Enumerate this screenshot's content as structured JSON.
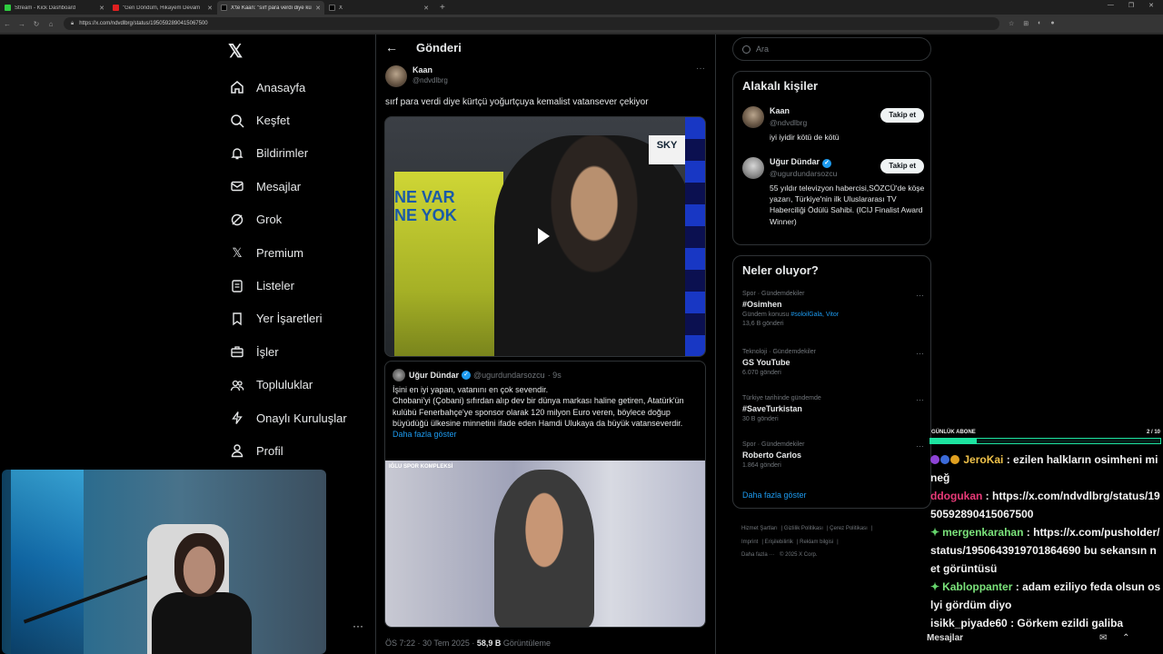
{
  "browser": {
    "tabs": [
      {
        "title": "Stream - Kick Dashboard",
        "color": "#2ecc40",
        "active": false
      },
      {
        "title": "\"Geri Döndüm, Hikayem Devam",
        "color": "#e02020",
        "active": false
      },
      {
        "title": "X'te Kaan: \"sırf para verdi diye kü",
        "color": "#000000",
        "active": true
      },
      {
        "title": "X",
        "color": "#000000",
        "active": false
      }
    ],
    "url": "https://x.com/ndvdlbrg/status/1950592890415067500"
  },
  "nav": {
    "items": [
      {
        "label": "Anasayfa",
        "icon": "home-icon"
      },
      {
        "label": "Keşfet",
        "icon": "search-icon"
      },
      {
        "label": "Bildirimler",
        "icon": "bell-icon"
      },
      {
        "label": "Mesajlar",
        "icon": "mail-icon"
      },
      {
        "label": "Grok",
        "icon": "grok-icon"
      },
      {
        "label": "Premium",
        "icon": "x-icon"
      },
      {
        "label": "Listeler",
        "icon": "list-icon"
      },
      {
        "label": "Yer İşaretleri",
        "icon": "bookmark-icon"
      },
      {
        "label": "İşler",
        "icon": "briefcase-icon"
      },
      {
        "label": "Topluluklar",
        "icon": "people-icon"
      },
      {
        "label": "Onaylı Kuruluşlar",
        "icon": "lightning-icon"
      },
      {
        "label": "Profil",
        "icon": "person-icon"
      }
    ]
  },
  "post": {
    "header_title": "Gönderi",
    "author_name": "Kaan",
    "author_handle": "@ndvdlbrg",
    "text": "sırf para verdi diye kürtçü yoğurtçuya kemalist vatansever çekiyor",
    "video_overlay_text": "NE VAR\nNE YOK",
    "video_logo": "SKY",
    "quote": {
      "name": "Uğur Dündar",
      "handle": "@ugurdundarsozcu",
      "time": "· 9s",
      "body": "İşini en iyi yapan, vatanını en çok sevendir.\nChobani'yi (Çobani) sıfırdan alıp dev bir dünya markası haline getiren, Atatürk'ün kulübü Fenerbahçe'ye sponsor olarak 120 milyon Euro veren, böylece doğup büyüdüğü ülkesine minnetini ifade eden Hamdi Ulukaya da büyük vatanseverdir.",
      "more": "Daha fazla göster",
      "image_banner": "IĞLU SPOR KOMPLEKSİ"
    },
    "meta_time": "ÖS 7:22 · 30 Tem 2025 · ",
    "meta_views": "58,9 B",
    "meta_views_label": " Görüntüleme"
  },
  "search": {
    "placeholder": "Ara"
  },
  "people": {
    "title": "Alakalı kişiler",
    "list": [
      {
        "name": "Kaan",
        "handle": "@ndvdlbrg",
        "bio": "iyi iyidir kötü de kötü",
        "follow": "Takip et",
        "verified": false
      },
      {
        "name": "Uğur Dündar",
        "handle": "@ugurdundarsozcu",
        "bio": "55 yıldır televizyon habercisi,SÖZCÜ'de köşe yazarı, Türkiye'nin ilk Uluslararası TV Haberciliği Ödülü Sahibi. (ICIJ Finalist Award Winner)",
        "follow": "Takip et",
        "verified": true
      }
    ]
  },
  "trends": {
    "title": "Neler oluyor?",
    "items": [
      {
        "category": "Spor · Gündemdekiler",
        "name": "#Osimhen",
        "context_prefix": "Gündem konusu ",
        "context_link": "#soloilGala, Vitor",
        "count": "13,6 B gönderi"
      },
      {
        "category": "Teknoloji · Gündemdekiler",
        "name": "GS YouTube",
        "context_prefix": "",
        "context_link": "",
        "count": "6.070 gönderi"
      },
      {
        "category": "Türkiye tarihinde gündemde",
        "name": "#SaveTurkistan",
        "context_prefix": "",
        "context_link": "",
        "count": "30 B gönderi"
      },
      {
        "category": "Spor · Gündemdekiler",
        "name": "Roberto Carlos",
        "context_prefix": "",
        "context_link": "",
        "count": "1.864 gönderi"
      }
    ],
    "more": "Daha fazla göster"
  },
  "footer": {
    "links": [
      "Hizmet Şartları",
      "Gizlilik Politikası",
      "Çerez Politikası",
      "Imprint",
      "Erişilebilirlik",
      "Reklam bilgisi",
      "Daha fazla ···",
      "© 2025 X Corp."
    ]
  },
  "stream": {
    "sub_label": "GÜNLÜK ABONE",
    "sub_count": "2 / 10",
    "sub_progress": 0.2,
    "messages": [
      {
        "user": "JeroKai",
        "text": "ezilen halkların osimheni mi neğ",
        "user_color": "#f0c24a"
      },
      {
        "user": "ddogukan",
        "text": "https://x.com/ndvdlbrg/status/1950592890415067500",
        "user_color": "#e83a78"
      },
      {
        "user": "mergenkarahan",
        "text": "https://x.com/pusholder/status/1950643919701864690 bu sekansın net görüntüsü",
        "user_color": "#7be37b"
      },
      {
        "user": "Kabloppanter",
        "text": "adam eziliyo feda olsun oslyi gördüm diyo",
        "user_color": "#7be37b"
      },
      {
        "user": "isikk_piyade60",
        "text": "Görkem ezildi galiba",
        "user_color": "#f2f2f2"
      }
    ],
    "bottom_label": "Mesajlar"
  }
}
